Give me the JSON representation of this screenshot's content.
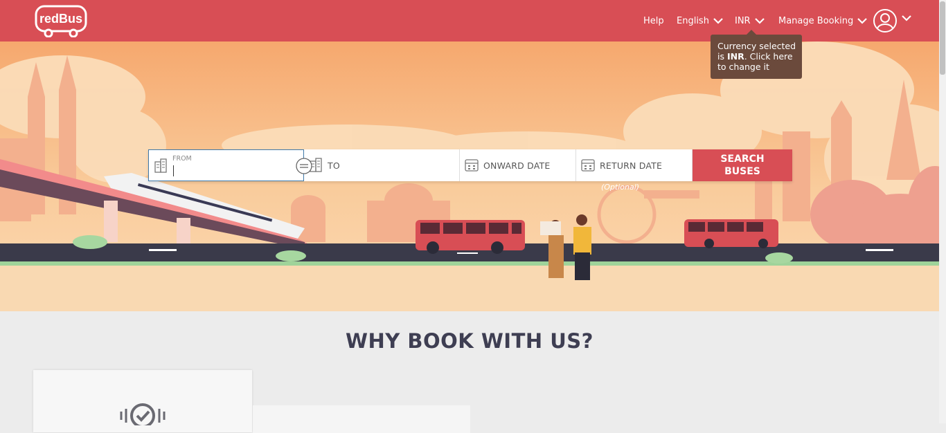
{
  "brand": {
    "logo_text": "redBus",
    "primary_color": "#d84e55"
  },
  "nav": {
    "help": "Help",
    "language": "English",
    "currency": "INR",
    "manage_booking": "Manage Booking"
  },
  "tooltip": {
    "prefix": "Currency selected is ",
    "currency": "INR",
    "suffix": ". Click here to change it"
  },
  "search": {
    "from_label": "FROM",
    "to_label": "TO",
    "onward_label": "ONWARD DATE",
    "return_label": "RETURN DATE",
    "return_optional": "(Optional)",
    "button_label": "SEARCH BUSES"
  },
  "section": {
    "title": "WHY BOOK WITH US?"
  },
  "icons": [
    "bus-logo-icon",
    "chevron-down-icon",
    "user-avatar-icon",
    "building-icon",
    "calendar-icon",
    "swap-icon",
    "verified-check-icon"
  ]
}
